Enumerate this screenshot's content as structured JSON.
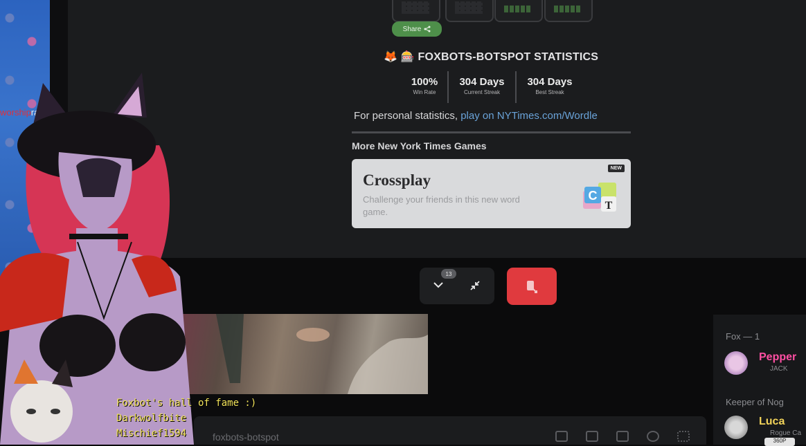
{
  "game": {
    "share_label": "Share",
    "stats_title": "🦊 🎰 FOXBOTS-BOTSPOT STATISTICS",
    "stats": [
      {
        "value": "100%",
        "label": "Win Rate"
      },
      {
        "value": "304 Days",
        "label": "Current Streak"
      },
      {
        "value": "304 Days",
        "label": "Best Streak"
      }
    ],
    "personal_prefix": "For personal statistics, ",
    "personal_link": "play on NYTimes.com/Wordle",
    "more_games_heading": "More New York Times Games",
    "card": {
      "badge": "NEW",
      "title": "Crossplay",
      "description": "Challenge your friends in this new word game.",
      "logo_letter": "C"
    }
  },
  "controls": {
    "notification_count": "13"
  },
  "chat": {
    "channel_placeholder": "foxbots-botspot"
  },
  "members": {
    "group_fox": "Fox — 1",
    "member_pepper": "Pepper",
    "pepper_sub": "JACK",
    "group_keeper": "Keeper of Nog",
    "member_luca": "Luca",
    "luca_sub": "Rogue Ca",
    "small_badge": "360P"
  },
  "overlay": {
    "name_red": "worship",
    "name_rest": "rahm",
    "hall_of_fame_title": "Foxbot's hall of fame :)",
    "hall_of_fame": [
      "Darkwolfbite",
      "Mischief1594"
    ]
  },
  "colors": {
    "share_green": "#4e8f4a",
    "link_blue": "#6aa3d9",
    "end_call_red": "#e03a3e",
    "pepper_pink": "#ff4fa3",
    "luca_gold": "#f2d35a",
    "hall_yellow": "#f3e45a"
  }
}
